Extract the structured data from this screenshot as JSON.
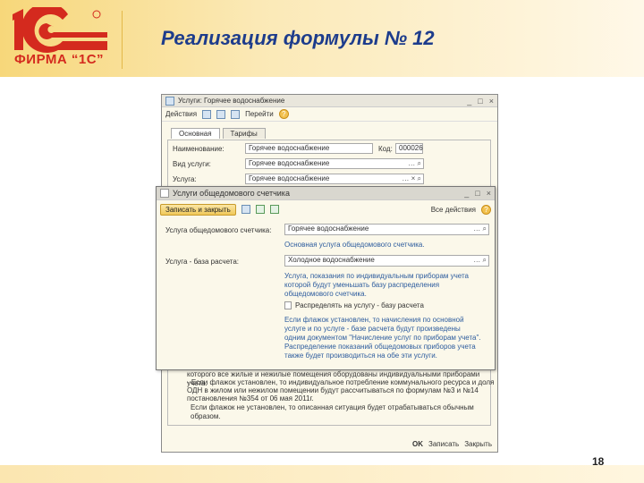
{
  "slide": {
    "title": "Реализация формулы № 12",
    "page_number": "18",
    "logo_text": "ФИРМА “1С”"
  },
  "back_window": {
    "title": "Услуги: Горячее водоснабжение",
    "toolbar": {
      "actions": "Действия",
      "goto": "Перейти"
    },
    "tabs": [
      "Основная",
      "Тарифы"
    ],
    "fields": {
      "name_label": "Наименование:",
      "name_value": "Горячее водоснабжение",
      "code_label": "Код:",
      "code_value": "000026",
      "kind_label": "Вид услуги:",
      "kind_value": "Горячее водоснабжение",
      "service_label": "Услуга:",
      "service_value": "Горячее водоснабжение"
    },
    "notes": [
      "которого все жилые и нежилые помещения оборудованы индивидуальными приборами учета.",
      "- Если флажок установлен, то индивидуальное потребление коммунального ресурса и доля",
      "ОДН в жилом или нежилом помещении будут рассчитываться по формулам №3 и №14",
      "постановления №354 от 06 мая 2011г.",
      "Если флажок не установлен, то описанная ситуация будет отрабатываться обычным образом."
    ],
    "buttons": {
      "ok": "OK",
      "save": "Записать",
      "close": "Закрыть"
    }
  },
  "dialog": {
    "title": "Услуги общедомового счетчика",
    "save_close": "Записать и закрыть",
    "all_actions": "Все действия",
    "meter_service_label": "Услуга общедомового счетчика:",
    "meter_service_value": "Горячее водоснабжение",
    "meter_service_hint": "Основная услуга общедомового счетчика.",
    "base_service_label": "Услуга - база расчета:",
    "base_service_value": "Холодное водоснабжение",
    "base_service_hint": [
      "Услуга, показания по индивидуальным приборам учета",
      "которой будут уменьшать базу распределения",
      "общедомового счетчика."
    ],
    "checkbox_label": "Распределять на услугу - базу расчета",
    "checkbox_checked": false,
    "checkbox_hint": [
      "Если флажок установлен, то начисления по основной",
      "услуге и по услуге - базе расчета будут произведены",
      "одним документом \"Начисление услуг по приборам учета\".",
      "Распределение показаний общедомовых приборов учета",
      "также будет производиться на обе эти услуги."
    ]
  }
}
